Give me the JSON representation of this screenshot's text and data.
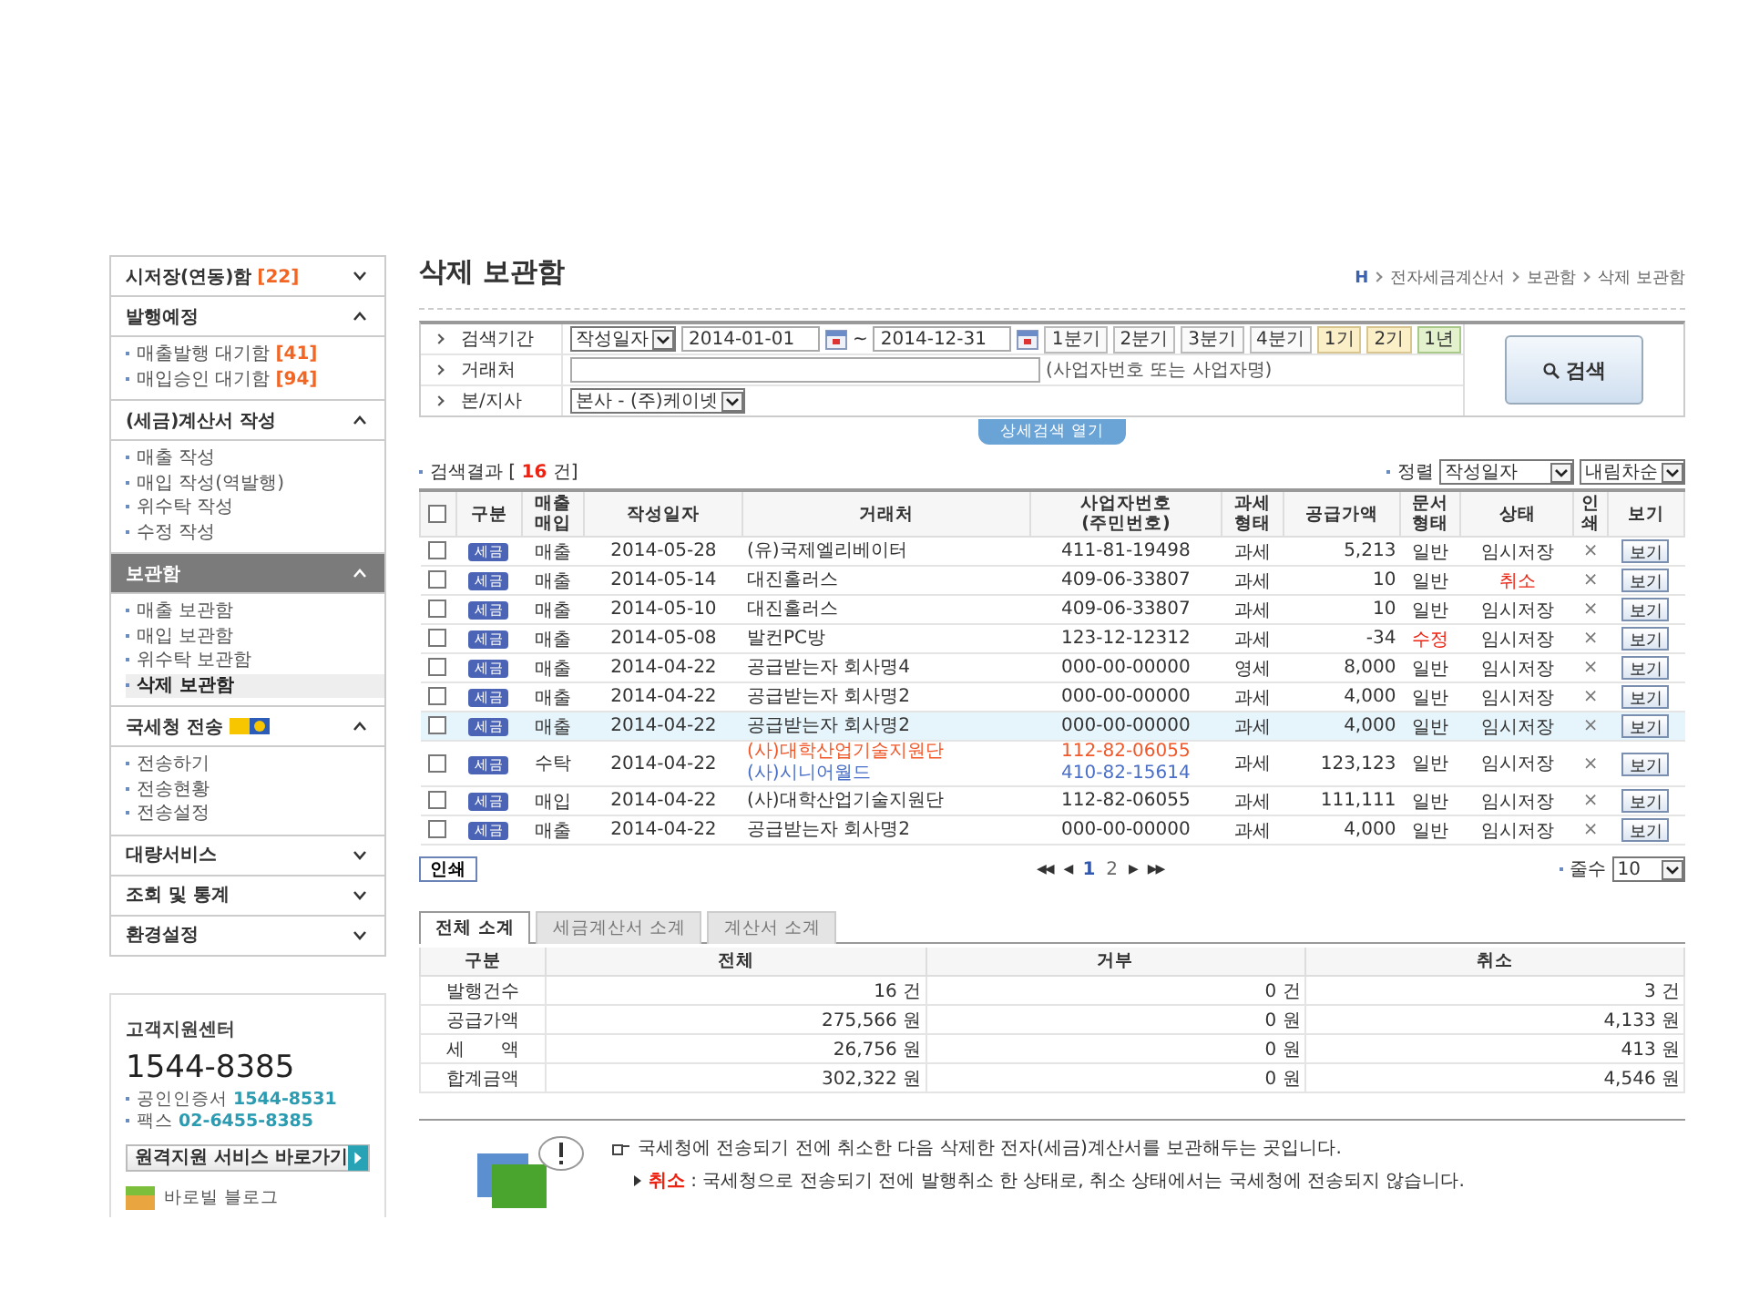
{
  "sidebar": {
    "sections": [
      {
        "title": "시저장(연동)함",
        "count": "[22]",
        "expanded": false,
        "selected": false
      },
      {
        "title": "발행예정",
        "expanded": true,
        "selected": false,
        "items": [
          {
            "label": "매출발행 대기함",
            "count": "[41]",
            "selected": false
          },
          {
            "label": "매입승인 대기함",
            "count": "[94]",
            "selected": false
          }
        ]
      },
      {
        "title": "(세금)계산서 작성",
        "expanded": true,
        "selected": false,
        "items": [
          {
            "label": "매출 작성",
            "selected": false
          },
          {
            "label": "매입 작성(역발행)",
            "selected": false
          },
          {
            "label": "위수탁 작성",
            "selected": false
          },
          {
            "label": "수정 작성",
            "selected": false
          }
        ]
      },
      {
        "title": "보관함",
        "expanded": true,
        "selected": true,
        "items": [
          {
            "label": "매출 보관함",
            "selected": false
          },
          {
            "label": "매입 보관함",
            "selected": false
          },
          {
            "label": "위수탁 보관함",
            "selected": false
          },
          {
            "label": "삭제 보관함",
            "selected": true
          }
        ]
      },
      {
        "title": "국세청 전송",
        "badge": true,
        "expanded": true,
        "selected": false,
        "items": [
          {
            "label": "전송하기",
            "selected": false
          },
          {
            "label": "전송현황",
            "selected": false
          },
          {
            "label": "전송설정",
            "selected": false
          }
        ]
      },
      {
        "title": "대량서비스",
        "expanded": false,
        "selected": false
      },
      {
        "title": "조회 및 통계",
        "expanded": false,
        "selected": false
      },
      {
        "title": "환경설정",
        "expanded": false,
        "selected": false
      }
    ]
  },
  "support": {
    "title": "고객지원센터",
    "phone": "1544-8385",
    "lines": [
      {
        "label": "공인인증서",
        "value": "1544-8531"
      },
      {
        "label": "팩스",
        "value": "02-6455-8385"
      }
    ],
    "remote_button": "원격지원 서비스 바로가기",
    "blog": "바로빌 블로그"
  },
  "page": {
    "title": "삭제 보관함",
    "breadcrumb": [
      "H",
      "전자세금계산서",
      "보관함",
      "삭제 보관함"
    ]
  },
  "search": {
    "period_label": "검색기간",
    "period_type": "작성일자",
    "date_from": "2014-01-01",
    "range_separator": "~",
    "date_to": "2014-12-31",
    "quick_buttons": [
      {
        "label": "1분기",
        "kind": "quarter"
      },
      {
        "label": "2분기",
        "kind": "quarter"
      },
      {
        "label": "3분기",
        "kind": "quarter"
      },
      {
        "label": "4분기",
        "kind": "quarter"
      },
      {
        "label": "1기",
        "kind": "half"
      },
      {
        "label": "2기",
        "kind": "half"
      },
      {
        "label": "1년",
        "kind": "year"
      }
    ],
    "partner_label": "거래처",
    "partner_hint": "(사업자번호 또는 사업자명)",
    "branch_label": "본/지사",
    "branch_value": "본사 - (주)케이넷",
    "search_button": "검색",
    "detail_toggle": "상세검색 열기"
  },
  "results": {
    "label": "검색결과 [",
    "count": "16",
    "suffix": "건]",
    "sort_label": "정렬",
    "sort_field": "작성일자",
    "sort_order": "내림차순"
  },
  "table": {
    "select_all": {
      "checked": false
    },
    "columns": [
      "구분",
      "매출\n매입",
      "작성일자",
      "거래처",
      "사업자번호\n(주민번호)",
      "과세\n형태",
      "공급가액",
      "문서\n형태",
      "상태",
      "인\n쇄",
      "보기"
    ],
    "rows": [
      {
        "checked": false,
        "selected": false,
        "category": "세금",
        "type": "매출",
        "date": "2014-05-28",
        "parties": [
          {
            "name": "(유)국제엘리베이터",
            "biz_no": "411-81-19498",
            "color": "#333333"
          }
        ],
        "tax": "과세",
        "amount": "5,213",
        "doc": "일반",
        "doc_alert": false,
        "status": "임시저장",
        "status_alert": false,
        "print": "×",
        "view": "보기"
      },
      {
        "checked": false,
        "selected": false,
        "category": "세금",
        "type": "매출",
        "date": "2014-05-14",
        "parties": [
          {
            "name": "대진홀러스",
            "biz_no": "409-06-33807",
            "color": "#333333"
          }
        ],
        "tax": "과세",
        "amount": "10",
        "doc": "일반",
        "doc_alert": false,
        "status": "취소",
        "status_alert": true,
        "print": "×",
        "view": "보기"
      },
      {
        "checked": false,
        "selected": false,
        "category": "세금",
        "type": "매출",
        "date": "2014-05-10",
        "parties": [
          {
            "name": "대진홀러스",
            "biz_no": "409-06-33807",
            "color": "#333333"
          }
        ],
        "tax": "과세",
        "amount": "10",
        "doc": "일반",
        "doc_alert": false,
        "status": "임시저장",
        "status_alert": false,
        "print": "×",
        "view": "보기"
      },
      {
        "checked": false,
        "selected": false,
        "category": "세금",
        "type": "매출",
        "date": "2014-05-08",
        "parties": [
          {
            "name": "발컨PC방",
            "biz_no": "123-12-12312",
            "color": "#333333"
          }
        ],
        "tax": "과세",
        "amount": "-34",
        "doc": "수정",
        "doc_alert": true,
        "status": "임시저장",
        "status_alert": false,
        "print": "×",
        "view": "보기"
      },
      {
        "checked": false,
        "selected": false,
        "category": "세금",
        "type": "매출",
        "date": "2014-04-22",
        "parties": [
          {
            "name": "공급받는자 회사명4",
            "biz_no": "000-00-00000",
            "color": "#333333"
          }
        ],
        "tax": "영세",
        "amount": "8,000",
        "doc": "일반",
        "doc_alert": false,
        "status": "임시저장",
        "status_alert": false,
        "print": "×",
        "view": "보기"
      },
      {
        "checked": false,
        "selected": false,
        "category": "세금",
        "type": "매출",
        "date": "2014-04-22",
        "parties": [
          {
            "name": "공급받는자 회사명2",
            "biz_no": "000-00-00000",
            "color": "#333333"
          }
        ],
        "tax": "과세",
        "amount": "4,000",
        "doc": "일반",
        "doc_alert": false,
        "status": "임시저장",
        "status_alert": false,
        "print": "×",
        "view": "보기"
      },
      {
        "checked": false,
        "selected": true,
        "category": "세금",
        "type": "매출",
        "date": "2014-04-22",
        "parties": [
          {
            "name": "공급받는자 회사명2",
            "biz_no": "000-00-00000",
            "color": "#333333"
          }
        ],
        "tax": "과세",
        "amount": "4,000",
        "doc": "일반",
        "doc_alert": false,
        "status": "임시저장",
        "status_alert": false,
        "print": "×",
        "view": "보기"
      },
      {
        "checked": false,
        "selected": false,
        "category": "세금",
        "type": "수탁",
        "date": "2014-04-22",
        "parties": [
          {
            "name": "(사)대학산업기술지원단",
            "biz_no": "112-82-06055",
            "color": "#f0582a"
          },
          {
            "name": "(사)시니어월드",
            "biz_no": "410-82-15614",
            "color": "#4a6fc8"
          }
        ],
        "tax": "과세",
        "amount": "123,123",
        "doc": "일반",
        "doc_alert": false,
        "status": "임시저장",
        "status_alert": false,
        "print": "×",
        "view": "보기"
      },
      {
        "checked": false,
        "selected": false,
        "category": "세금",
        "type": "매입",
        "date": "2014-04-22",
        "parties": [
          {
            "name": "(사)대학산업기술지원단",
            "biz_no": "112-82-06055",
            "color": "#333333"
          }
        ],
        "tax": "과세",
        "amount": "111,111",
        "doc": "일반",
        "doc_alert": false,
        "status": "임시저장",
        "status_alert": false,
        "print": "×",
        "view": "보기"
      },
      {
        "checked": false,
        "selected": false,
        "category": "세금",
        "type": "매출",
        "date": "2014-04-22",
        "parties": [
          {
            "name": "공급받는자 회사명2",
            "biz_no": "000-00-00000",
            "color": "#333333"
          }
        ],
        "tax": "과세",
        "amount": "4,000",
        "doc": "일반",
        "doc_alert": false,
        "status": "임시저장",
        "status_alert": false,
        "print": "×",
        "view": "보기"
      }
    ]
  },
  "print_button": "인쇄",
  "pager": {
    "first": "◀◀",
    "prev": "◀",
    "pages": [
      {
        "label": "1",
        "selected": true
      },
      {
        "label": "2",
        "selected": false
      }
    ],
    "next": "▶",
    "last": "▶▶",
    "rows_label": "줄수",
    "rows_value": "10"
  },
  "summary": {
    "tabs": [
      {
        "label": "전체 소계",
        "selected": true
      },
      {
        "label": "세금계산서 소계",
        "selected": false
      },
      {
        "label": "계산서 소계",
        "selected": false
      }
    ],
    "columns": [
      "구분",
      "전체",
      "거부",
      "취소"
    ],
    "rows": [
      [
        "발행건수",
        "16 건",
        "0 건",
        "3 건"
      ],
      [
        "공급가액",
        "275,566 원",
        "0 원",
        "4,133 원"
      ],
      [
        "세　　액",
        "26,756 원",
        "0 원",
        "413 원"
      ],
      [
        "합계금액",
        "302,322 원",
        "0 원",
        "4,546 원"
      ]
    ]
  },
  "info": {
    "note": "국세청에 전송되기 전에 취소한 다음 삭제한 전자(세금)계산서를 보관해두는 곳입니다.",
    "bullets": [
      "**취소** : 국세청으로 전송되기 전에 발행취소 한 상태로, 취소 상태에서는 국세청에 전송되지 않습니다."
    ]
  }
}
